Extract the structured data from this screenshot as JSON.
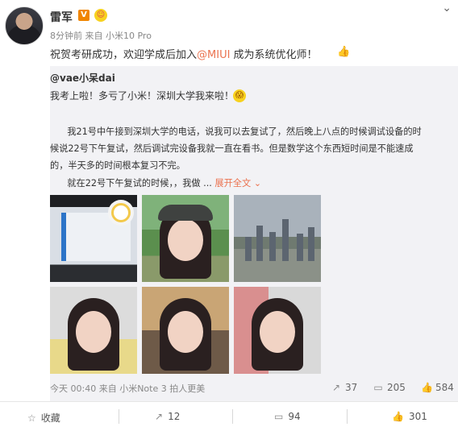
{
  "post": {
    "author": "雷军",
    "verified_badge": "V",
    "member_badge": "☺",
    "meta": "8分钟前 来自 小米10 Pro",
    "text_prefix": "祝贺考研成功，欢迎学成后加入",
    "mention": "@MIUI",
    "text_suffix": " 成为系统优化师！",
    "thumb_icon": "👍"
  },
  "repost": {
    "user": "@vae小呆dai",
    "line1": "我考上啦！多亏了小米！深圳大学我来啦！",
    "emoji": "😱",
    "para1_line1": "我21号中午接到深圳大学的电话，说我可以去复试了，然后晚上八点的时候调试设备的时",
    "para1_line2": "候说22号下午复试，然后调试完设备我就一直在看书。但是数学这个东西短时间是不能速成",
    "para1_line3": "的，半天多的时间根本复习不完。",
    "para2": "就在22号下午复试的时候，，我做 ...",
    "expand": "展开全文",
    "expand_icon": "⌄",
    "footer_meta": "今天 00:40 来自 小米Note 3 拍人更美",
    "stats": {
      "reposts": "37",
      "comments": "205",
      "likes": "584"
    }
  },
  "actions": {
    "favorite": "收藏",
    "repost_count": "12",
    "comment_count": "94",
    "like_count": "301"
  },
  "colors": {
    "accent": "#eb7350",
    "panel": "#f2f2f5",
    "vbadge": "#f08500"
  }
}
